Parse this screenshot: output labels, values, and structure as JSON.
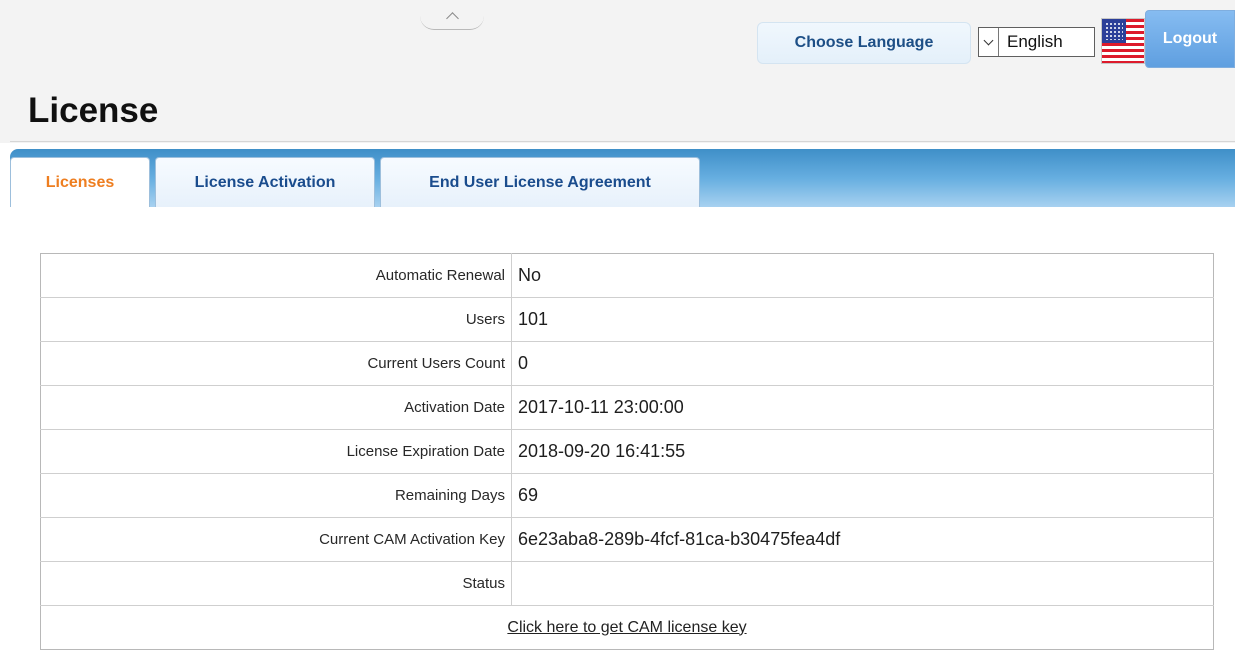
{
  "header": {
    "choose_language_label": "Choose Language",
    "language_selected": "English",
    "logout_label": "Logout"
  },
  "page": {
    "title": "License"
  },
  "tabs": [
    {
      "label": "Licenses",
      "active": true
    },
    {
      "label": "License Activation",
      "active": false
    },
    {
      "label": "End User License Agreement",
      "active": false
    }
  ],
  "license_table": {
    "rows": [
      {
        "label": "Automatic Renewal",
        "value": "No"
      },
      {
        "label": "Users",
        "value": "101"
      },
      {
        "label": "Current Users Count",
        "value": "0"
      },
      {
        "label": "Activation Date",
        "value": "2017-10-11 23:00:00"
      },
      {
        "label": "License Expiration Date",
        "value": "2018-09-20 16:41:55"
      },
      {
        "label": "Remaining Days",
        "value": "69"
      },
      {
        "label": "Current CAM Activation Key",
        "value": "6e23aba8-289b-4fcf-81ca-b30475fea4df"
      },
      {
        "label": "Status",
        "value": ""
      }
    ],
    "link_label": "Click here to get CAM license key"
  },
  "colors": {
    "tab_bar": "#66aee0",
    "active_tab_text": "#ee7e20",
    "tab_text": "#1a4c8d",
    "logout_button": "#5f9fe0"
  },
  "icons": {
    "collapse": "chevron-up-icon",
    "flag": "us-flag-icon",
    "dropdown": "chevron-down-icon"
  }
}
